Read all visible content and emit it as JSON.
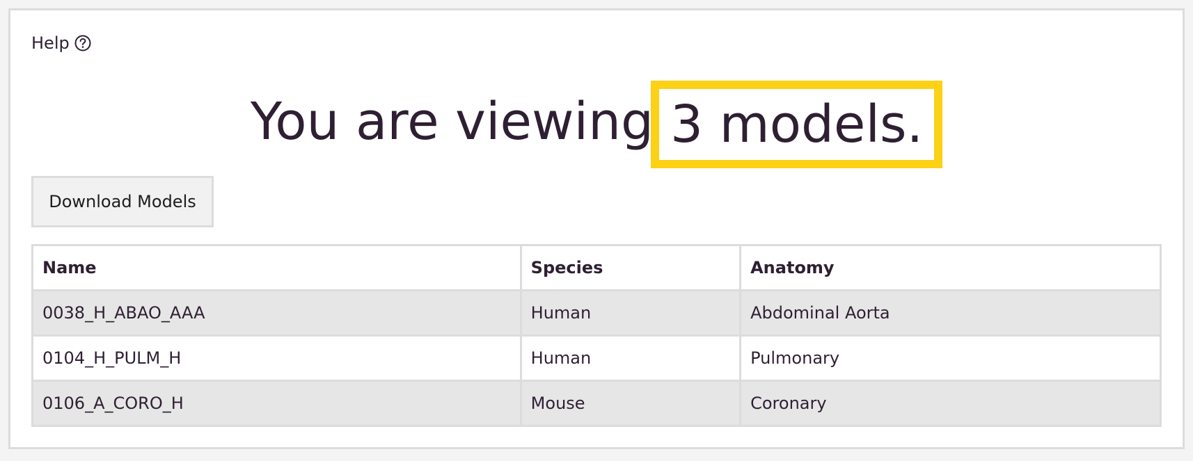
{
  "help": {
    "label": "Help",
    "icon": "question-circle-icon"
  },
  "heading": {
    "prefix": "You are viewing",
    "highlight": "3 models.",
    "highlight_color": "#fcd116",
    "text_color": "#2f1f33"
  },
  "actions": {
    "download_label": "Download Models"
  },
  "table": {
    "headers": [
      "Name",
      "Species",
      "Anatomy"
    ],
    "rows": [
      [
        "0038_H_ABAO_AAA",
        "Human",
        "Abdominal Aorta"
      ],
      [
        "0104_H_PULM_H",
        "Human",
        "Pulmonary"
      ],
      [
        "0106_A_CORO_H",
        "Mouse",
        "Coronary"
      ]
    ],
    "stripe_color": "#e6e6e6",
    "border_color": "#dcdcdc"
  }
}
